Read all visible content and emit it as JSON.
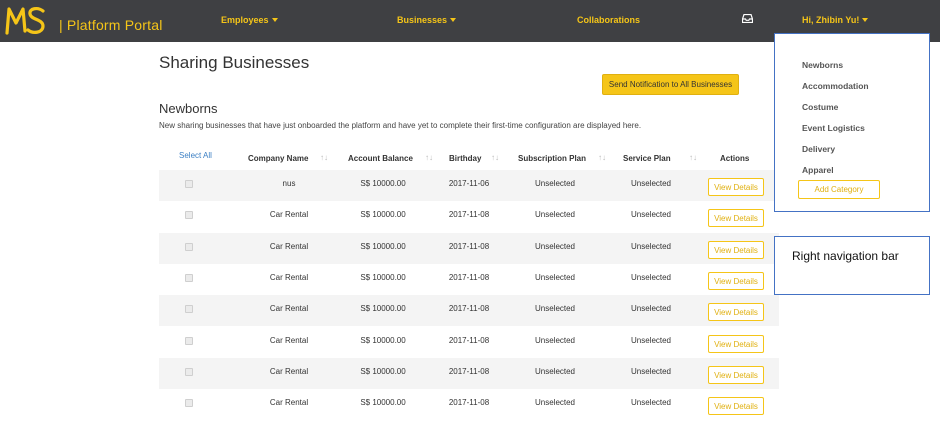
{
  "app": {
    "logo_text": "| Platform Portal",
    "brand_color": "#f5c518",
    "navbar_color": "#3f4043"
  },
  "nav": {
    "items": [
      {
        "label": "Employees",
        "has_caret": true
      },
      {
        "label": "Businesses",
        "has_caret": true
      },
      {
        "label": "Collaborations",
        "has_caret": false
      }
    ],
    "inbox_icon": "inbox-icon",
    "user_label": "Hi, Zhibin Yu!"
  },
  "page": {
    "title": "Sharing Businesses",
    "notify_button": "Send Notification to All Businesses",
    "section_title": "Newborns",
    "section_description": "New sharing businesses that have just onboarded the platform and have yet to complete their first-time configuration are displayed here."
  },
  "table": {
    "select_all": "Select All",
    "headers": [
      "Company Name",
      "Account Balance",
      "Birthday",
      "Subscription Plan",
      "Service Plan",
      "Actions"
    ],
    "sort_icon": "↑↓",
    "action_label": "View Details",
    "rows": [
      [
        "nus",
        "S$ 10000.00",
        "2017-11-06",
        "Unselected",
        "Unselected"
      ],
      [
        "Car Rental",
        "S$ 10000.00",
        "2017-11-08",
        "Unselected",
        "Unselected"
      ],
      [
        "Car Rental",
        "S$ 10000.00",
        "2017-11-08",
        "Unselected",
        "Unselected"
      ],
      [
        "Car Rental",
        "S$ 10000.00",
        "2017-11-08",
        "Unselected",
        "Unselected"
      ],
      [
        "Car Rental",
        "S$ 10000.00",
        "2017-11-08",
        "Unselected",
        "Unselected"
      ],
      [
        "Car Rental",
        "S$ 10000.00",
        "2017-11-08",
        "Unselected",
        "Unselected"
      ],
      [
        "Car Rental",
        "S$ 10000.00",
        "2017-11-08",
        "Unselected",
        "Unselected"
      ],
      [
        "Car Rental",
        "S$ 10000.00",
        "2017-11-08",
        "Unselected",
        "Unselected"
      ]
    ]
  },
  "categories": {
    "items": [
      "Newborns",
      "Accommodation",
      "Costume",
      "Event Logistics",
      "Delivery",
      "Apparel"
    ],
    "add_label": "Add Category"
  },
  "annotation": {
    "label": "Right navigation bar",
    "border_color": "#4472c4"
  }
}
